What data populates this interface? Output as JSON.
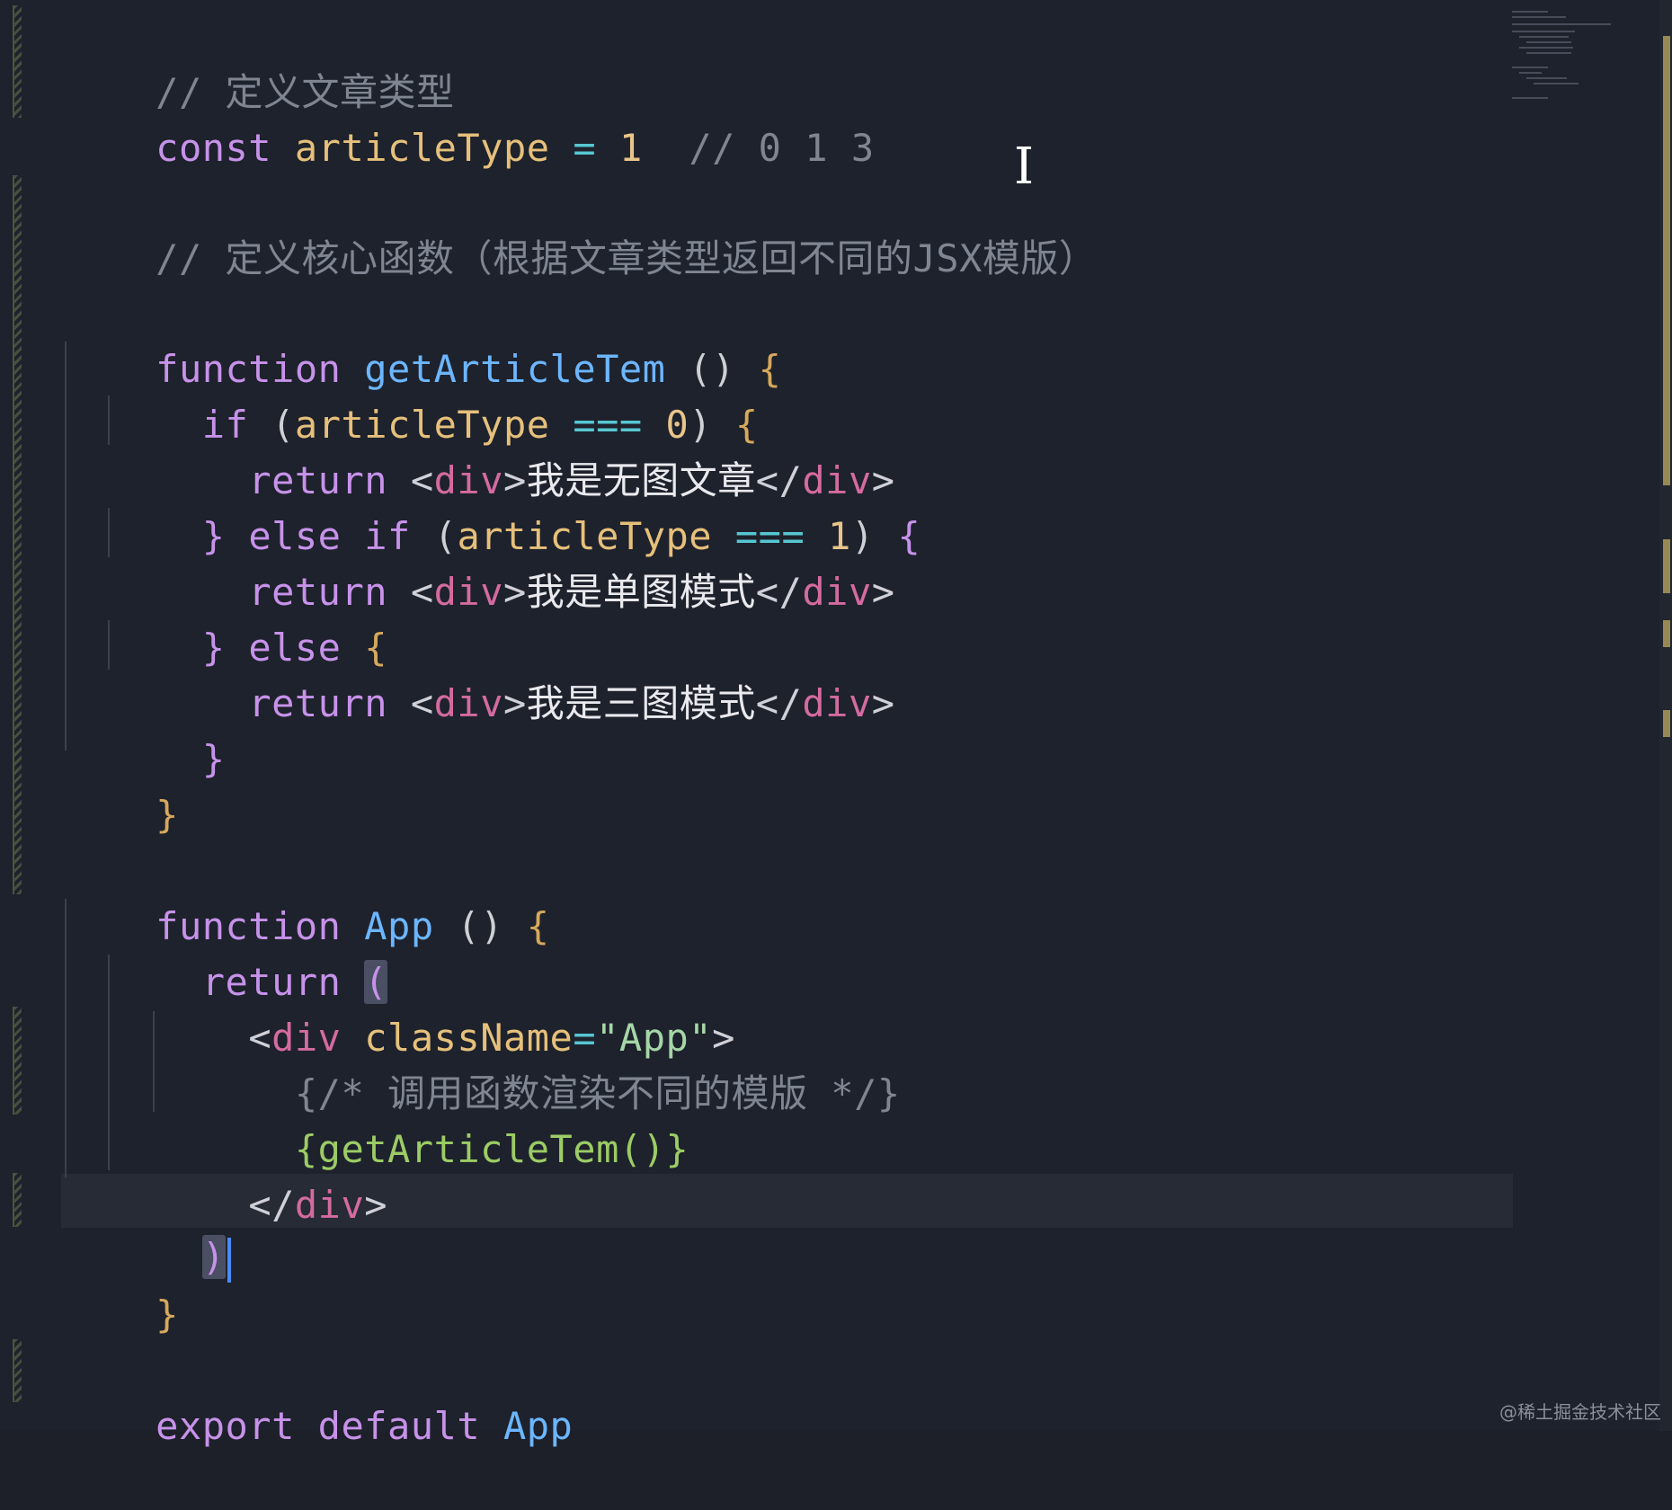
{
  "editor": {
    "language": "jsx",
    "lines": [
      {
        "comment": "// 定义文章类型"
      },
      {
        "kw": "const",
        "name": "articleType",
        "op": "=",
        "value": "1",
        "comment": "// 0 1 3"
      },
      {
        "comment": "// 定义核心函数（根据文章类型返回不同的JSX模版）"
      },
      {
        "kw": "function",
        "name": "getArticleTem",
        "open": "()",
        "brace": "{"
      },
      {
        "kw": "if",
        "open": "(",
        "var": "articleType",
        "op": "===",
        "value": "0",
        "close": ")",
        "brace": "{"
      },
      {
        "kw": "return",
        "tag_open_lt": "<",
        "tag": "div",
        "tag_open_gt": ">",
        "text": "我是无图文章",
        "tag_close_lt": "</",
        "tag_close": "div",
        "tag_close_gt": ">"
      },
      {
        "brace_close": "}",
        "kw": "else if",
        "open": "(",
        "var": "articleType",
        "op": "===",
        "value": "1",
        "close": ")",
        "brace": "{"
      },
      {
        "kw": "return",
        "tag_open_lt": "<",
        "tag": "div",
        "tag_open_gt": ">",
        "text": "我是单图模式",
        "tag_close_lt": "</",
        "tag_close": "div",
        "tag_close_gt": ">"
      },
      {
        "brace_close": "}",
        "kw": "else",
        "brace": "{"
      },
      {
        "kw": "return",
        "tag_open_lt": "<",
        "tag": "div",
        "tag_open_gt": ">",
        "text": "我是三图模式",
        "tag_close_lt": "</",
        "tag_close": "div",
        "tag_close_gt": ">"
      },
      {
        "brace_close": "}"
      },
      {
        "brace_close": "}"
      },
      {
        "kw": "function",
        "name": "App",
        "open": "()",
        "brace": "{"
      },
      {
        "kw": "return",
        "paren": "("
      },
      {
        "lt": "<",
        "tag": "div",
        "attr": "className",
        "eq": "=",
        "str": "\"App\"",
        "gt": ">"
      },
      {
        "text": "{/* 调用函数渲染不同的模版 */}"
      },
      {
        "text": "{getArticleTem()}"
      },
      {
        "lt": "</",
        "tag": "div",
        "gt": ">"
      },
      {
        "paren": ")"
      },
      {
        "brace_close": "}"
      },
      {
        "kw": "export default",
        "name": "App"
      }
    ]
  },
  "watermark": "@稀土掘金技术社区",
  "icons": {
    "text_cursor": "i-beam-cursor-icon"
  }
}
